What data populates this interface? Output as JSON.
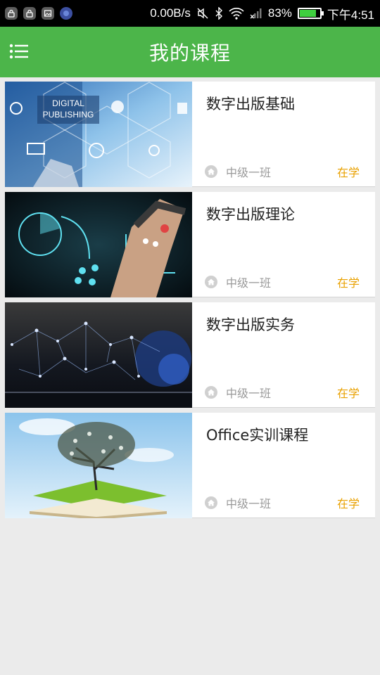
{
  "status_bar": {
    "speed": "0.00B/s",
    "battery": "83%",
    "battery_level": 0.83,
    "time": "下午4:51",
    "notification_icons": [
      "lock-app-icon",
      "lock-app-icon",
      "image-icon",
      "browser-icon"
    ],
    "signal_icons": [
      "mute-icon",
      "bluetooth-icon",
      "wifi-icon",
      "cellular-signal-icon"
    ]
  },
  "header": {
    "title": "我的课程",
    "menu_icon": "list-menu-icon",
    "color": "#4cb54a"
  },
  "courses": [
    {
      "title": "数字出版基础",
      "class_name": "中级一班",
      "status": "在学",
      "thumb_caption": [
        "DIGITAL",
        "PUBLISHING"
      ]
    },
    {
      "title": "数字出版理论",
      "class_name": "中级一班",
      "status": "在学"
    },
    {
      "title": "数字出版实务",
      "class_name": "中级一班",
      "status": "在学"
    },
    {
      "title": "Office实训课程",
      "class_name": "中级一班",
      "status": "在学"
    }
  ],
  "colors": {
    "status_text": "#e9a100",
    "accent": "#4cb54a"
  }
}
